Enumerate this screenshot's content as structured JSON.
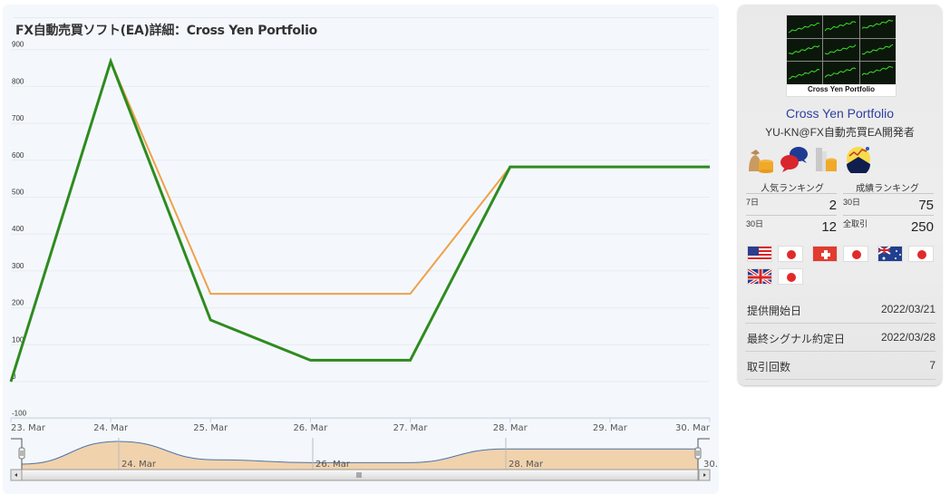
{
  "page": {
    "title": "FX自動売買ソフト(EA)詳細：Cross Yen Portfolio"
  },
  "chart_data": {
    "type": "line",
    "title": "FX自動売買ソフト(EA)詳細：Cross Yen Portfolio",
    "xlabel": "",
    "ylabel": "",
    "x": [
      "23. Mar",
      "24. Mar",
      "25. Mar",
      "26. Mar",
      "27. Mar",
      "28. Mar",
      "30. Mar"
    ],
    "x_day_index": [
      0,
      1,
      2,
      3,
      4,
      5,
      7
    ],
    "x_tick_labels": [
      "23. Mar",
      "24. Mar",
      "25. Mar",
      "26. Mar",
      "27. Mar",
      "28. Mar",
      "29. Mar",
      "30. Mar"
    ],
    "y_tick_labels": [
      "-100",
      "0",
      "100",
      "200",
      "300",
      "400",
      "500",
      "600",
      "700",
      "800",
      "900"
    ],
    "ylim": [
      -100,
      900
    ],
    "xlim_days": [
      0,
      7
    ],
    "grid": true,
    "legend": "none",
    "series": [
      {
        "name": "orange-line",
        "color": "#f0a04a",
        "values": [
          0,
          868,
          238,
          238,
          238,
          582,
          582
        ]
      },
      {
        "name": "green-line",
        "color": "#2e8b1f",
        "values": [
          0,
          868,
          167,
          58,
          58,
          582,
          582
        ]
      }
    ],
    "navigator": {
      "tick_labels": [
        "24. Mar",
        "26. Mar",
        "28. Mar",
        "30."
      ],
      "tick_days": [
        1,
        3,
        5,
        7
      ],
      "fill_color": "#f0d2ad",
      "line_color": "#4f74a8"
    }
  },
  "sidebar": {
    "thumbnail_label": "Cross Yen Portfolio",
    "ea_name": "Cross Yen Portfolio",
    "developer": "YU-KN@FX自動売買EA開発者",
    "badges": [
      "money-bag-coins-icon",
      "chat-bubbles-icon",
      "building-coins-icon",
      "trend-chart-icon"
    ],
    "popularity_ranking": {
      "heading": "人気ランキング",
      "rows": [
        {
          "label": "7日",
          "value": "2"
        },
        {
          "label": "30日",
          "value": "12"
        }
      ]
    },
    "performance_ranking": {
      "heading": "成績ランキング",
      "rows": [
        {
          "label": "30日",
          "value": "75"
        },
        {
          "label": "全取引",
          "value": "250"
        }
      ]
    },
    "currency_pairs": [
      [
        "USD",
        "JPY"
      ],
      [
        "CHF",
        "JPY"
      ],
      [
        "AUD",
        "JPY"
      ],
      [
        "GBP",
        "JPY"
      ]
    ],
    "info": [
      {
        "label": "提供開始日",
        "value": "2022/03/21"
      },
      {
        "label": "最終シグナル約定日",
        "value": "2022/03/28"
      },
      {
        "label": "取引回数",
        "value": "7"
      }
    ]
  }
}
